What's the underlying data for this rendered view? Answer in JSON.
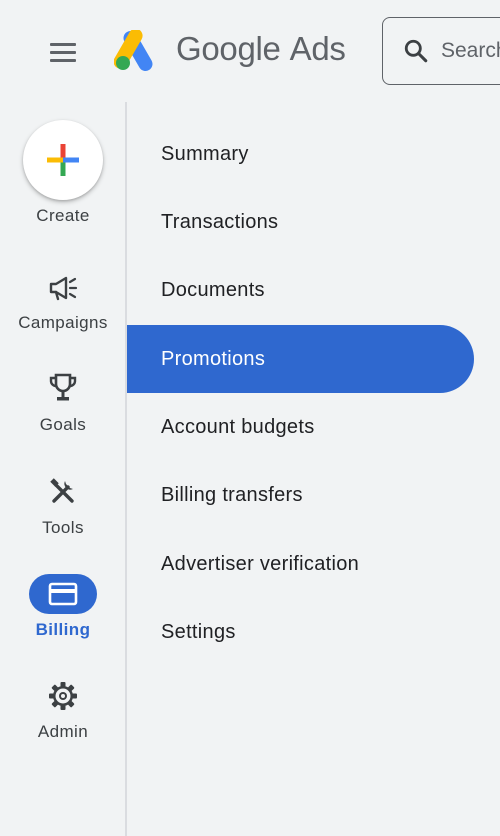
{
  "header": {
    "brand_google": "Google",
    "brand_ads": "Ads",
    "search_placeholder": "Search"
  },
  "rail": {
    "create_label": "Create",
    "items": [
      {
        "label": "Campaigns",
        "icon": "megaphone-icon"
      },
      {
        "label": "Goals",
        "icon": "trophy-icon"
      },
      {
        "label": "Tools",
        "icon": "tools-icon"
      },
      {
        "label": "Billing",
        "icon": "credit-card-icon",
        "active": true
      },
      {
        "label": "Admin",
        "icon": "gear-icon"
      }
    ]
  },
  "submenu": {
    "items": [
      {
        "label": "Summary"
      },
      {
        "label": "Transactions"
      },
      {
        "label": "Documents"
      },
      {
        "label": "Promotions",
        "active": true
      },
      {
        "label": "Account budgets"
      },
      {
        "label": "Billing transfers"
      },
      {
        "label": "Advertiser verification"
      },
      {
        "label": "Settings"
      }
    ]
  },
  "colors": {
    "accent": "#2f68cf",
    "background": "#f1f3f4",
    "text": "#202124",
    "muted": "#5f6368"
  }
}
